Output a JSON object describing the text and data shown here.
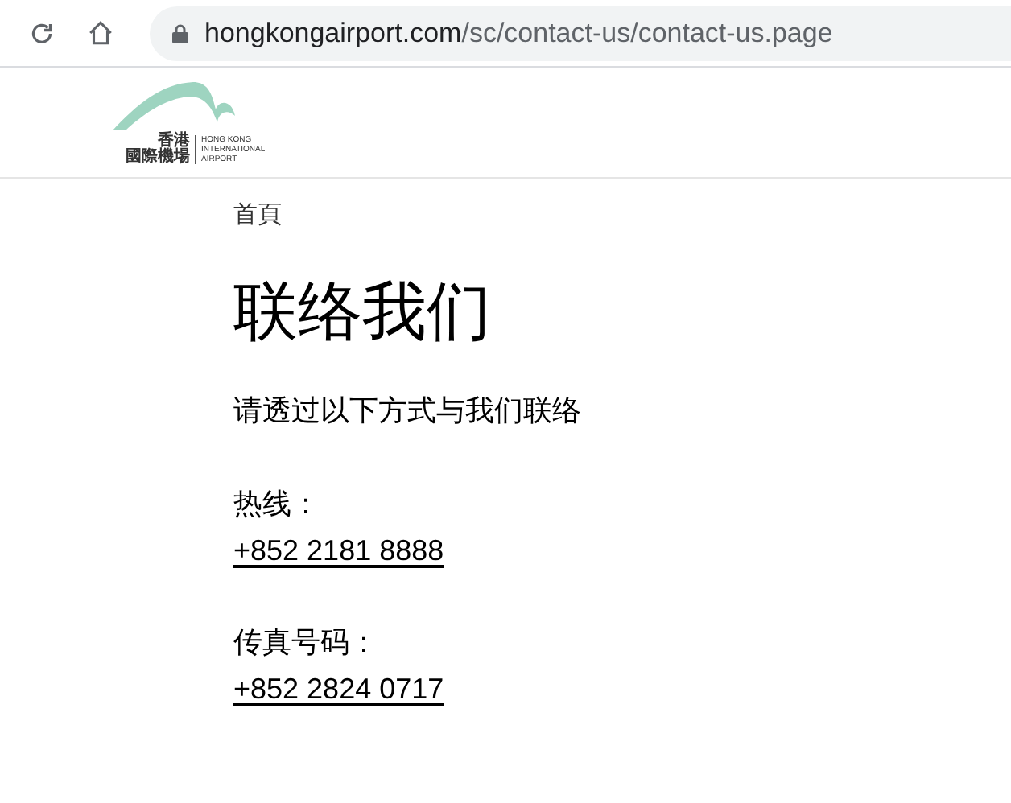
{
  "browser": {
    "url_host": "hongkongairport.com",
    "url_path": "/sc/contact-us/contact-us.page"
  },
  "logo": {
    "chinese_lines": [
      "香港",
      "國際機場"
    ],
    "english_lines": [
      "HONG KONG",
      "INTERNATIONAL",
      "AIRPORT"
    ]
  },
  "breadcrumb": "首頁",
  "title": "联络我们",
  "intro": "请透过以下方式与我们联络",
  "contacts": [
    {
      "label": "热线：",
      "number": "+852 2181 8888"
    },
    {
      "label": "传真号码：",
      "number": "+852 2824 0717"
    }
  ]
}
